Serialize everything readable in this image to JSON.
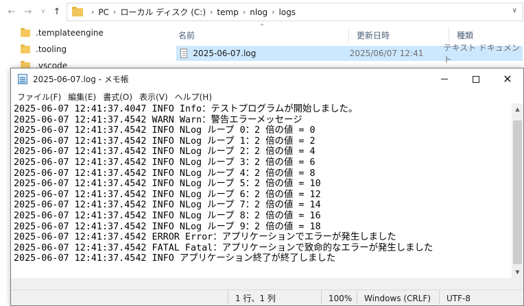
{
  "explorer": {
    "breadcrumb": [
      "PC",
      "ローカル ディスク (C:)",
      "temp",
      "nlog",
      "logs"
    ],
    "nav_items": [
      ".templateengine",
      ".tooling",
      ".vscode"
    ],
    "columns": {
      "name": "名前",
      "modified": "更新日時",
      "type": "種類"
    },
    "file": {
      "name": "2025-06-07.log",
      "modified": "2025/06/07 12:41",
      "type": "テキスト ドキュメント"
    }
  },
  "notepad": {
    "title": "2025-06-07.log - メモ帳",
    "menu": [
      "ファイル(F)",
      "編集(E)",
      "書式(O)",
      "表示(V)",
      "ヘルプ(H)"
    ],
    "lines": [
      "2025-06-07 12:41:37.4047 INFO Info：テストプログラムが開始しました。",
      "2025-06-07 12:41:37.4542 WARN Warn：警告エラーメッセージ",
      "2025-06-07 12:41:37.4542 INFO NLog ループ 0：2 倍の値 = 0",
      "2025-06-07 12:41:37.4542 INFO NLog ループ 1：2 倍の値 = 2",
      "2025-06-07 12:41:37.4542 INFO NLog ループ 2：2 倍の値 = 4",
      "2025-06-07 12:41:37.4542 INFO NLog ループ 3：2 倍の値 = 6",
      "2025-06-07 12:41:37.4542 INFO NLog ループ 4：2 倍の値 = 8",
      "2025-06-07 12:41:37.4542 INFO NLog ループ 5：2 倍の値 = 10",
      "2025-06-07 12:41:37.4542 INFO NLog ループ 6：2 倍の値 = 12",
      "2025-06-07 12:41:37.4542 INFO NLog ループ 7：2 倍の値 = 14",
      "2025-06-07 12:41:37.4542 INFO NLog ループ 8：2 倍の値 = 16",
      "2025-06-07 12:41:37.4542 INFO NLog ループ 9：2 倍の値 = 18",
      "2025-06-07 12:41:37.4542 ERROR Error：アプリケーションでエラーが発生しました",
      "2025-06-07 12:41:37.4542 FATAL Fatal：アプリケーションで致命的なエラーが発生しました",
      "2025-06-07 12:41:37.4542 INFO アプリケーション終了が終了しました"
    ],
    "status": {
      "position": "1 行、1 列",
      "zoom": "100%",
      "line_ending": "Windows (CRLF)",
      "encoding": "UTF-8"
    }
  }
}
